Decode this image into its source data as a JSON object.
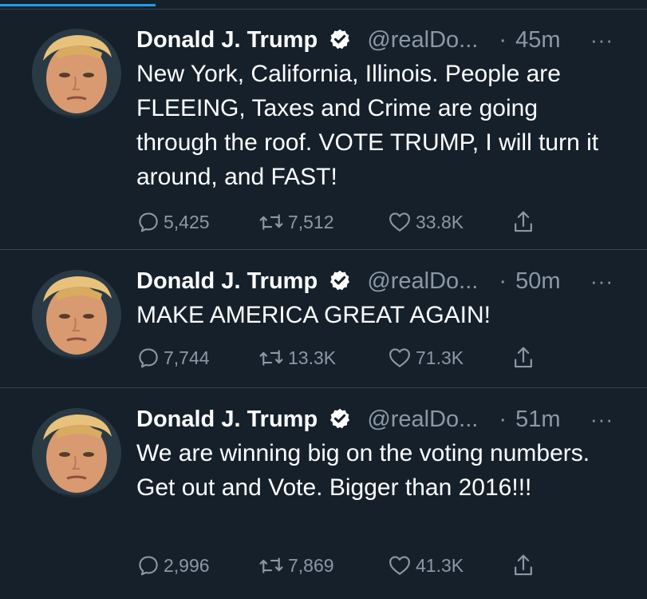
{
  "tweets": [
    {
      "name": "Donald J. Trump",
      "handle": "@realDo...",
      "dot": "·",
      "time": "45m",
      "more": "···",
      "text": "New York, California, Illinois. People are FLEEING, Taxes and Crime are going through the roof. VOTE TRUMP, I will turn it around, and FAST!",
      "replies": "5,425",
      "retweets": "7,512",
      "likes": "33.8K"
    },
    {
      "name": "Donald J. Trump",
      "handle": "@realDo...",
      "dot": "·",
      "time": "50m",
      "more": "···",
      "text": "MAKE AMERICA GREAT AGAIN!",
      "replies": "7,744",
      "retweets": "13.3K",
      "likes": "71.3K"
    },
    {
      "name": "Donald J. Trump",
      "handle": "@realDo...",
      "dot": "·",
      "time": "51m",
      "more": "···",
      "text": "We are winning big on the voting numbers. Get out and Vote. Bigger than 2016!!!",
      "replies": "2,996",
      "retweets": "7,869",
      "likes": "41.3K"
    }
  ],
  "icons": {
    "verified": "verified-badge-icon",
    "reply": "reply-icon",
    "retweet": "retweet-icon",
    "like": "heart-icon",
    "share": "share-icon",
    "more": "more-icon"
  },
  "colors": {
    "background": "#15202b",
    "divider": "#38444d",
    "text_primary": "#ffffff",
    "text_secondary": "#8b98a5",
    "accent": "#1d9bf0"
  },
  "loading_progress": 0.24
}
